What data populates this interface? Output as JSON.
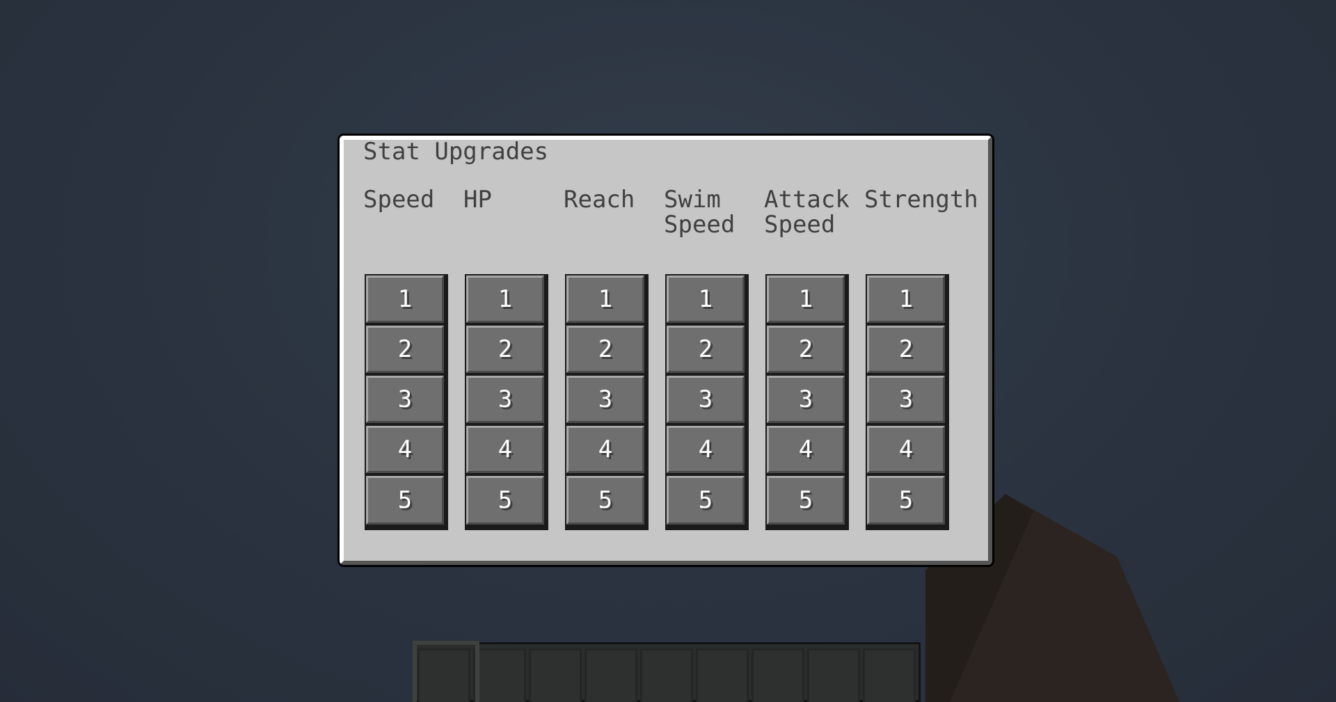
{
  "screen": {
    "title": "Stat Upgrades"
  },
  "stats": [
    {
      "label": "Speed",
      "levels": [
        "1",
        "2",
        "3",
        "4",
        "5"
      ]
    },
    {
      "label": "HP",
      "levels": [
        "1",
        "2",
        "3",
        "4",
        "5"
      ]
    },
    {
      "label": "Reach",
      "levels": [
        "1",
        "2",
        "3",
        "4",
        "5"
      ]
    },
    {
      "label": "Swim Speed",
      "levels": [
        "1",
        "2",
        "3",
        "4",
        "5"
      ]
    },
    {
      "label": "Attack Speed",
      "levels": [
        "1",
        "2",
        "3",
        "4",
        "5"
      ]
    },
    {
      "label": "Strength",
      "levels": [
        "1",
        "2",
        "3",
        "4",
        "5"
      ]
    }
  ],
  "hotbar": {
    "slot_count": 9,
    "selected_slot": 1
  },
  "colors": {
    "panel_background": "#c6c6c6",
    "label_text": "#404040",
    "button_face": "#6f6f6f",
    "button_text": "#ffffff",
    "sky": "#323b4a"
  }
}
